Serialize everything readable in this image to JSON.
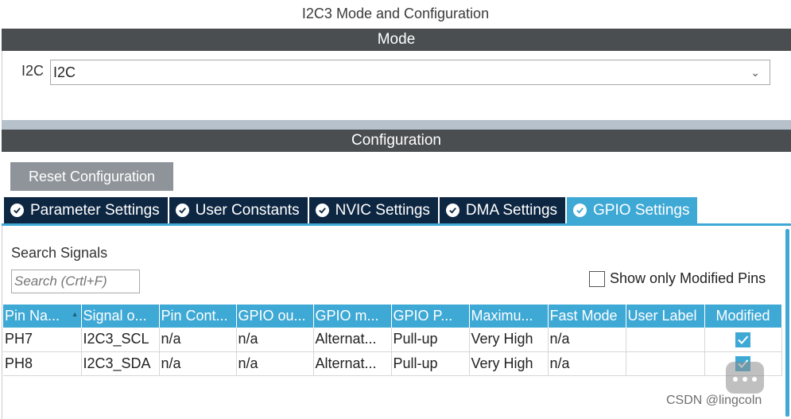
{
  "window": {
    "title": "I2C3 Mode and Configuration"
  },
  "mode": {
    "header": "Mode",
    "field_label": "I2C",
    "selected_value": "I2C"
  },
  "configuration": {
    "header": "Configuration",
    "reset_label": "Reset Configuration",
    "tabs": [
      {
        "label": "Parameter Settings",
        "active": false
      },
      {
        "label": "User Constants",
        "active": false
      },
      {
        "label": "NVIC Settings",
        "active": false
      },
      {
        "label": "DMA Settings",
        "active": false
      },
      {
        "label": "GPIO Settings",
        "active": true
      }
    ]
  },
  "gpio": {
    "search_label": "Search Signals",
    "search_placeholder": "Search (Crtl+F)",
    "show_modified_label": "Show only Modified Pins",
    "columns": [
      "Pin Na...",
      "Signal o...",
      "Pin Cont...",
      "GPIO ou...",
      "GPIO m...",
      "GPIO P...",
      "Maximu...",
      "Fast Mode",
      "User Label",
      "Modified"
    ],
    "rows": [
      [
        "PH7",
        "I2C3_SCL",
        "n/a",
        "n/a",
        "Alternat...",
        "Pull-up",
        "Very High",
        "n/a",
        "",
        "checked"
      ],
      [
        "PH8",
        "I2C3_SDA",
        "n/a",
        "n/a",
        "Alternat...",
        "Pull-up",
        "Very High",
        "n/a",
        "",
        "checked"
      ]
    ]
  },
  "watermark": {
    "text": "CSDN @lingcoln"
  },
  "colors": {
    "accent": "#3fa9d6",
    "header_bar": "#4a4e51",
    "tab_dark": "#0d2642",
    "button_gray": "#8e9499"
  }
}
